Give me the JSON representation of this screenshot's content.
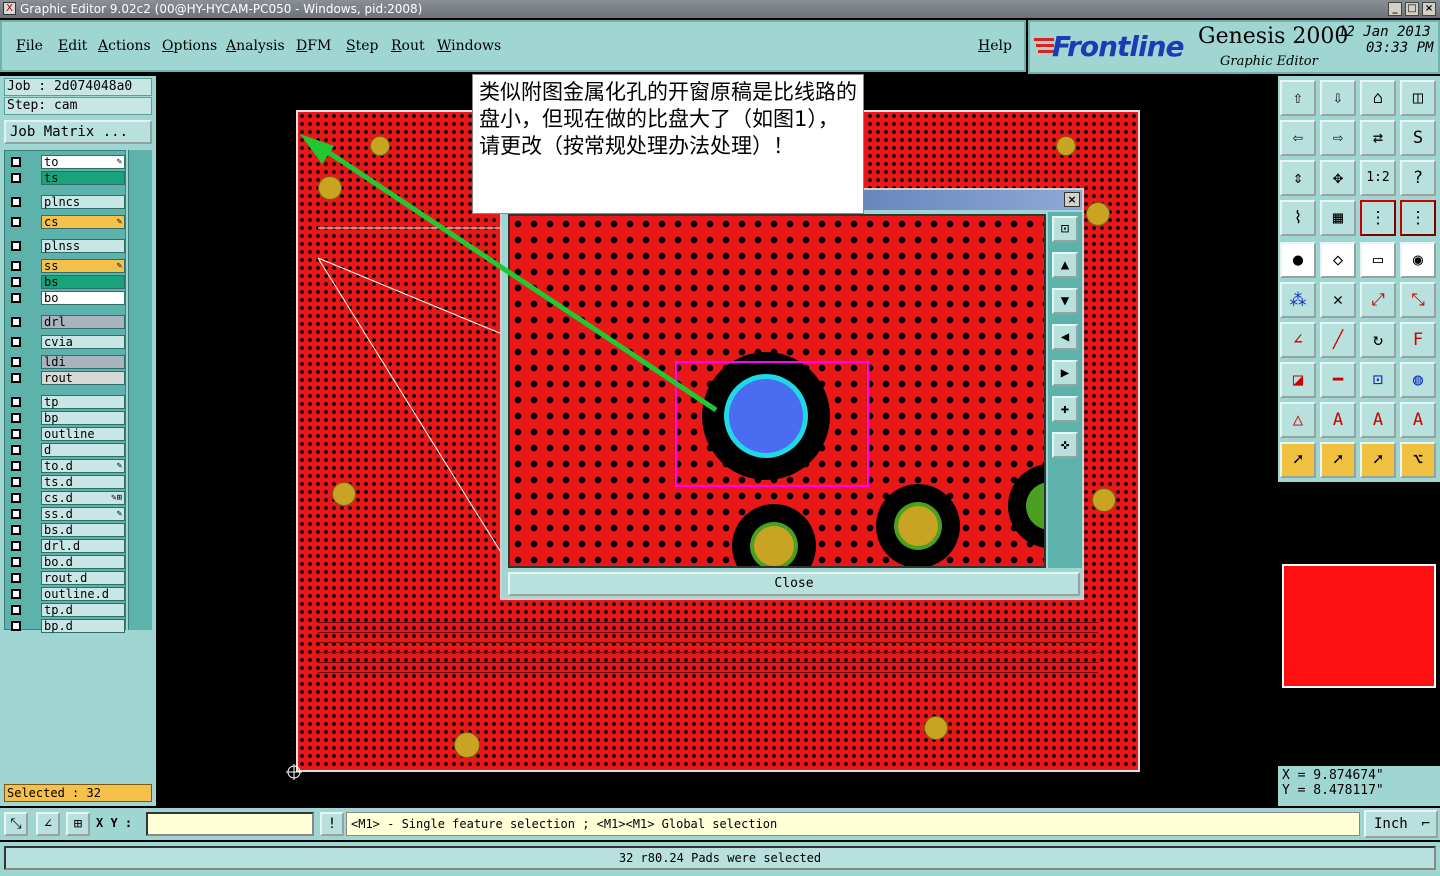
{
  "window": {
    "title": "Graphic Editor 9.02c2 (00@HY-HYCAM-PC050 - Windows, pid:2008)"
  },
  "menu": [
    "File",
    "Edit",
    "Actions",
    "Options",
    "Analysis",
    "DFM",
    "Step",
    "Rout",
    "Windows"
  ],
  "help_label": "Help",
  "brand": {
    "logo": "Frontline",
    "product": "Genesis 2000",
    "subtitle": "Graphic Editor",
    "date": "12 Jan 2013",
    "time": "03:33 PM"
  },
  "job": {
    "job_line": "Job : 2d074048a0",
    "step_line": "Step: cam",
    "matrix_button": "Job Matrix ..."
  },
  "layers": [
    {
      "name": "to",
      "color": "#ffffff",
      "mark": "✎"
    },
    {
      "name": "ts",
      "color": "#1aa37a",
      "mark": ""
    },
    {
      "name": "plncs",
      "color": "#c8e7e4",
      "mark": ""
    },
    {
      "name": "cs",
      "color": "#f5c14a",
      "mark": "✎"
    },
    {
      "name": "plnss",
      "color": "#c8e7e4",
      "mark": ""
    },
    {
      "name": "ss",
      "color": "#f5c14a",
      "mark": "✎"
    },
    {
      "name": "bs",
      "color": "#1aa37a",
      "mark": ""
    },
    {
      "name": "bo",
      "color": "#ffffff",
      "mark": ""
    },
    {
      "name": "drl",
      "color": "#a9b3bd",
      "mark": ""
    },
    {
      "name": "cvia",
      "color": "#c8e7e4",
      "mark": ""
    },
    {
      "name": "ldi",
      "color": "#a9b3bd",
      "mark": ""
    },
    {
      "name": "rout",
      "color": "#d8d8d8",
      "mark": ""
    },
    {
      "name": "tp",
      "color": "#c8e7e4",
      "mark": ""
    },
    {
      "name": "bp",
      "color": "#c8e7e4",
      "mark": ""
    },
    {
      "name": "outline",
      "color": "#c8e7e4",
      "mark": ""
    },
    {
      "name": "d",
      "color": "#c8e7e4",
      "mark": ""
    },
    {
      "name": "to.d",
      "color": "#c8e7e4",
      "mark": "✎"
    },
    {
      "name": "ts.d",
      "color": "#c8e7e4",
      "mark": ""
    },
    {
      "name": "cs.d",
      "color": "#c8e7e4",
      "mark": "✎⊞"
    },
    {
      "name": "ss.d",
      "color": "#c8e7e4",
      "mark": "✎"
    },
    {
      "name": "bs.d",
      "color": "#c8e7e4",
      "mark": ""
    },
    {
      "name": "drl.d",
      "color": "#c8e7e4",
      "mark": ""
    },
    {
      "name": "bo.d",
      "color": "#c8e7e4",
      "mark": ""
    },
    {
      "name": "rout.d",
      "color": "#c8e7e4",
      "mark": ""
    },
    {
      "name": "outline.d",
      "color": "#c8e7e4",
      "mark": ""
    },
    {
      "name": "tp.d",
      "color": "#c8e7e4",
      "mark": ""
    },
    {
      "name": "bp.d",
      "color": "#c8e7e4",
      "mark": ""
    }
  ],
  "selected_count": "Selected : 32",
  "annotation": "类似附图金属化孔的开窗原稿是比线路的盘小，但现在做的比盘大了（如图1），请更改（按常规处理办法处理）！",
  "zoom_dialog": {
    "close_label": "Close",
    "tools": [
      "zoom-fit-icon",
      "pan-up-icon",
      "pan-down-icon",
      "pan-left-icon",
      "pan-right-icon",
      "zoom-in-icon",
      "zoom-out-icon"
    ]
  },
  "coords": {
    "x": "X = 9.874674\"",
    "y": "Y = 8.478117\""
  },
  "xy_label": "X Y :",
  "xy_value": "",
  "hint": "<M1> - Single feature selection ; <M1><M1> Global selection",
  "unit": "Inch",
  "status_message": "32 r80.24 Pads were selected",
  "colors": {
    "copper": "#e81818",
    "panel": "#9fd6d2",
    "pad_gold": "#c9a422",
    "via_blue": "#4a6cf0",
    "highlight": "#ff00ff",
    "arrow": "#22c832"
  }
}
